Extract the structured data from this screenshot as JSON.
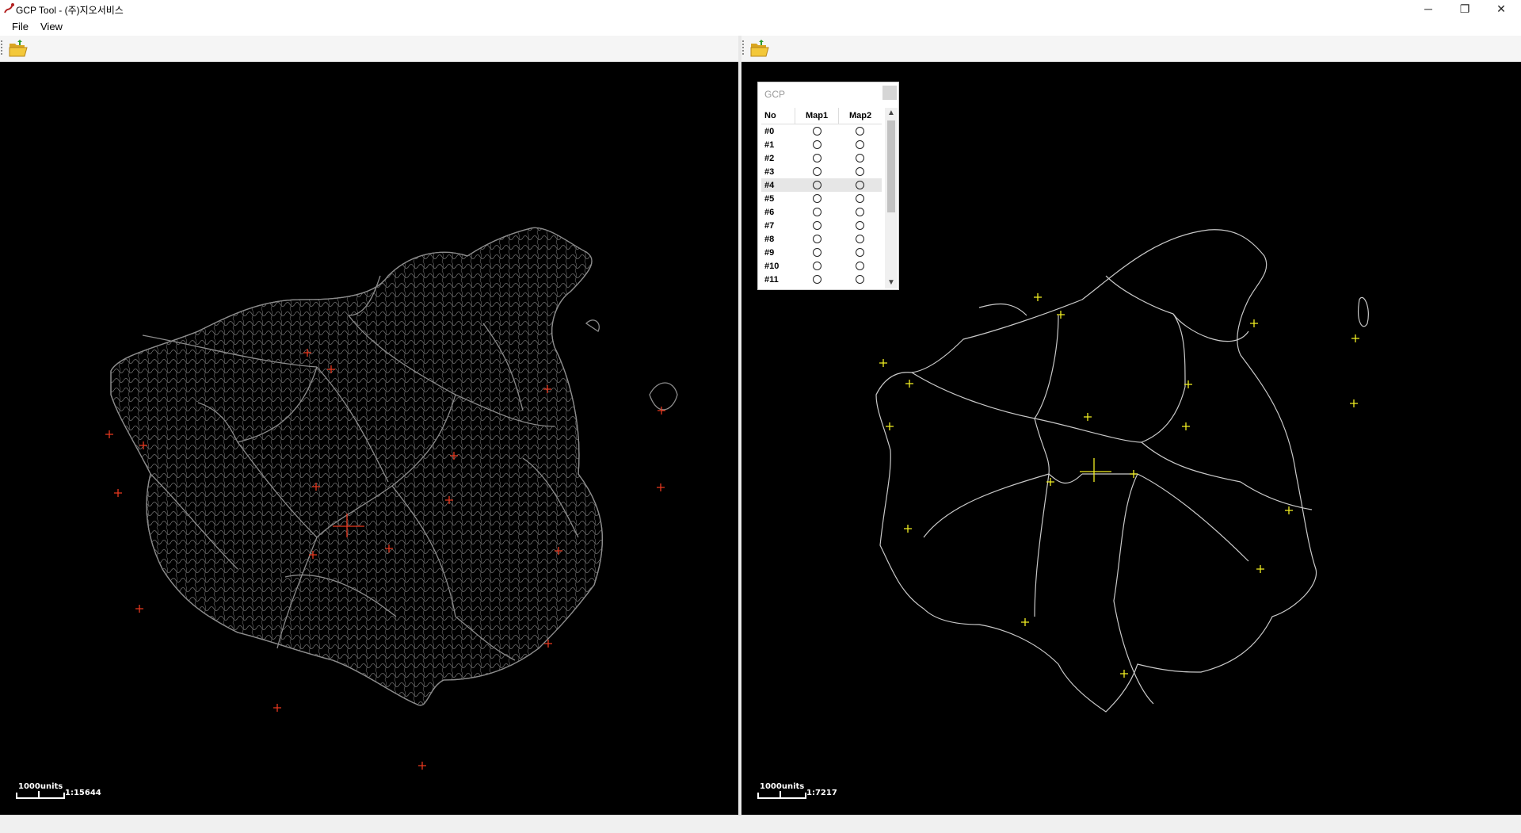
{
  "window": {
    "title": "GCP Tool - (주)지오서비스",
    "controls": [
      "─",
      "❐",
      "✕"
    ]
  },
  "menu": {
    "items": [
      "File",
      "View"
    ]
  },
  "toolbar": {
    "icon": "open-folder-icon"
  },
  "left_map": {
    "scale_units": "1000units",
    "scale_ratio": "1:15644",
    "line_color": "#8c8c8c",
    "marker_color": "#e8381e"
  },
  "right_map": {
    "scale_units": "1000units",
    "scale_ratio": "1:7217",
    "line_color": "#c9c9c9",
    "marker_color": "#f2ef22"
  },
  "gcp_panel": {
    "title": "GCP",
    "columns": [
      "No",
      "Map1",
      "Map2"
    ],
    "rows": [
      "#0",
      "#1",
      "#2",
      "#3",
      "#4",
      "#5",
      "#6",
      "#7",
      "#8",
      "#9",
      "#10",
      "#11"
    ],
    "selected_row": "#4"
  }
}
